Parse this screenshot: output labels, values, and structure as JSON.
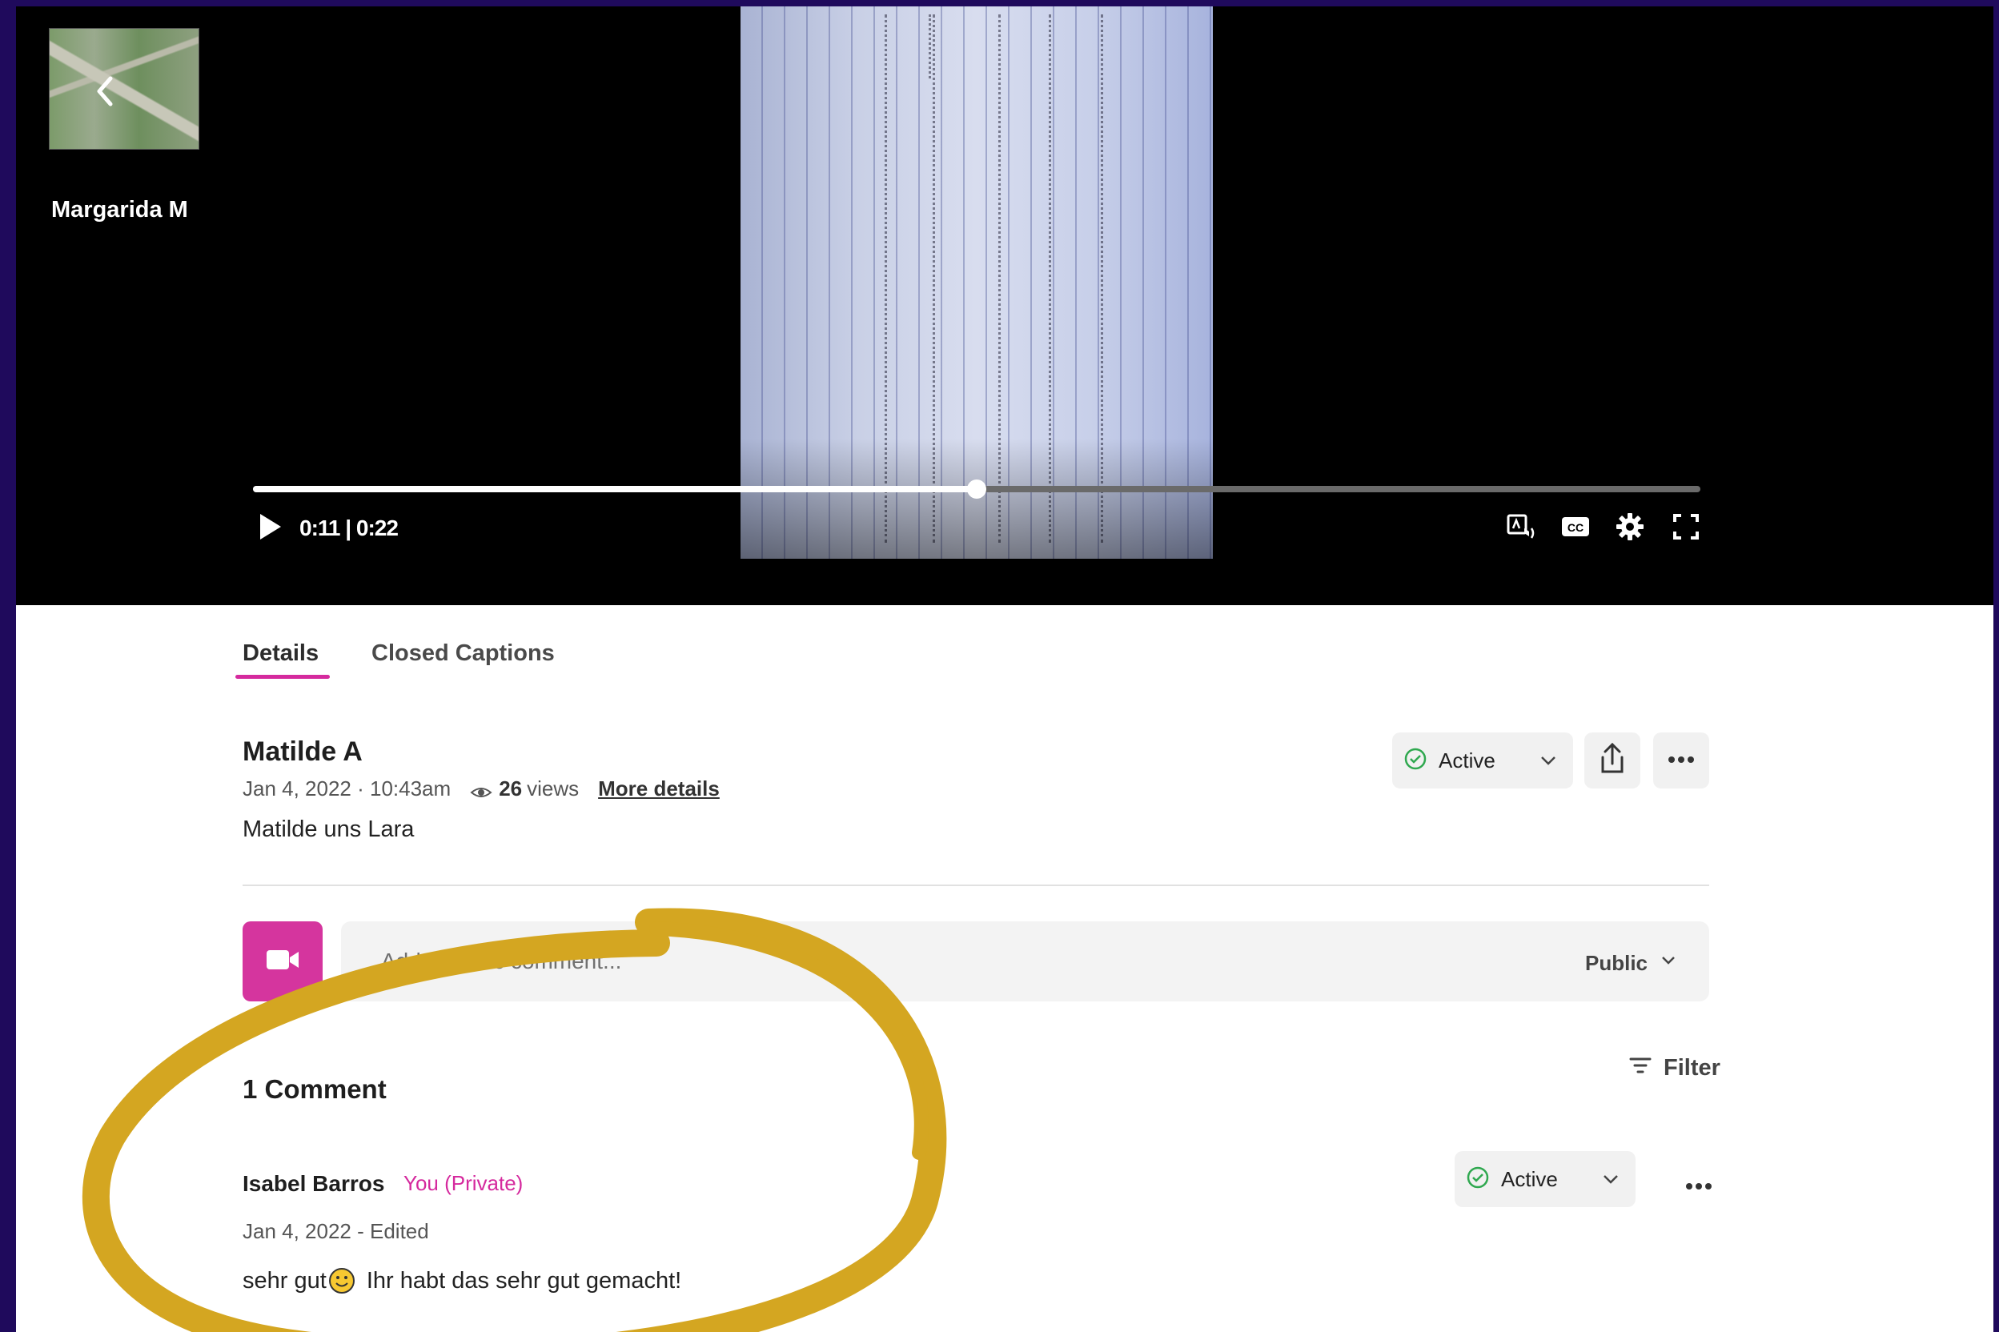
{
  "player": {
    "uploader_name": "Margarida M",
    "time_display": "0:11 | 0:22",
    "progress": 0.5,
    "icons": {
      "back": "chevron-left-icon",
      "play": "play-icon",
      "audio_description": "audio-description-icon",
      "captions": "closed-captions-icon",
      "settings": "gear-icon",
      "fullscreen": "fullscreen-icon"
    }
  },
  "tabs": [
    {
      "label": "Details",
      "active": true
    },
    {
      "label": "Closed Captions",
      "active": false
    }
  ],
  "details": {
    "title": "Matilde A",
    "date": "Jan 4, 2022 · 10:43am",
    "views_count": "26",
    "views_label": "views",
    "more_details": "More details",
    "description": "Matilde uns Lara",
    "status": "Active"
  },
  "composer": {
    "placeholder": "Add a public comment...",
    "visibility": "Public"
  },
  "comments": {
    "filter_label": "Filter",
    "count_label": "1 Comment",
    "items": [
      {
        "author": "Isabel Barros",
        "badge": "You (Private)",
        "date": "Jan 4, 2022 - Edited",
        "text_before": "sehr gut",
        "text_after": " Ihr habt das sehr gut gemacht!",
        "status": "Active"
      }
    ]
  },
  "colors": {
    "accent": "#d52a9e",
    "active_green": "#2fa84f",
    "background_frame": "#1f0a5c",
    "annotation": "#d4a621"
  }
}
